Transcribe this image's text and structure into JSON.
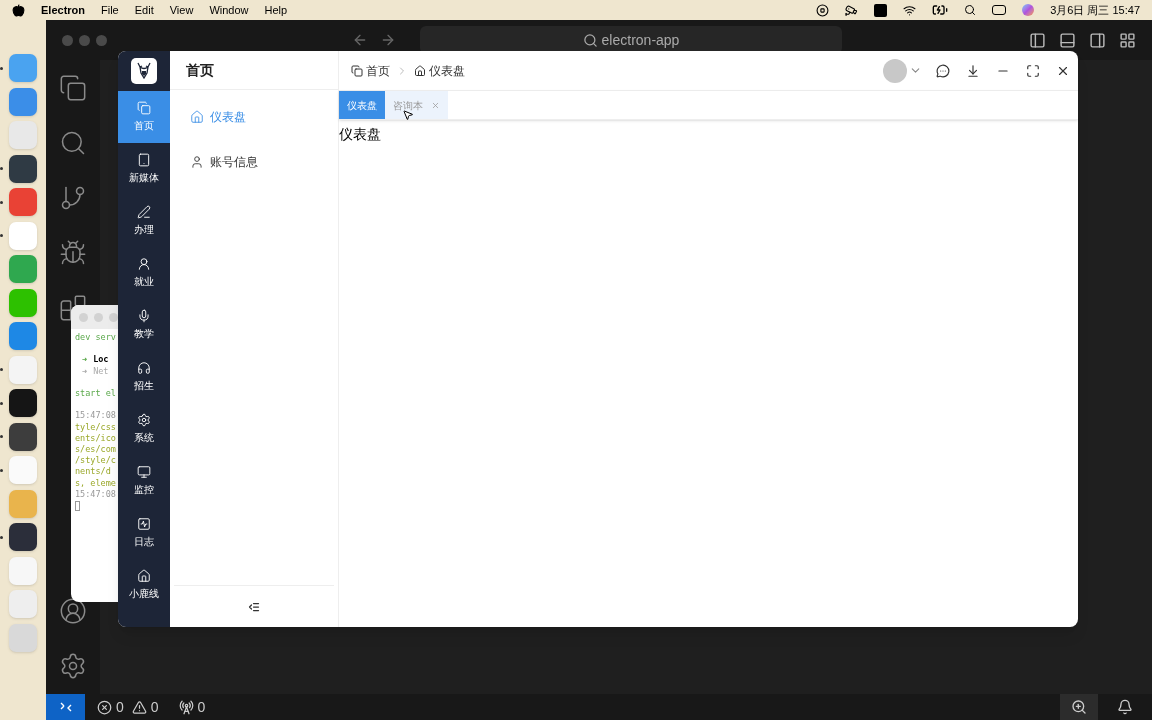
{
  "menubar": {
    "app": "Electron",
    "menus": [
      "File",
      "Edit",
      "View",
      "Window",
      "Help"
    ],
    "clock": "3月6日 周三 15:47"
  },
  "dock": {
    "items": [
      {
        "color": "#4aa3f0",
        "running": true
      },
      {
        "color": "#3b8ee8",
        "running": false
      },
      {
        "color": "#e8e8e8",
        "running": false
      },
      {
        "color": "#2f3a44",
        "running": true
      },
      {
        "color": "#e94235",
        "running": true
      },
      {
        "color": "#ffffff",
        "running": true
      },
      {
        "color": "#2fa84f",
        "running": false
      },
      {
        "color": "#2dc100",
        "running": false
      },
      {
        "color": "#1e88e5",
        "running": false
      },
      {
        "color": "#f4f4f4",
        "running": true
      },
      {
        "color": "#151515",
        "running": true
      },
      {
        "color": "#3d3d3d",
        "running": true
      },
      {
        "color": "#fafafa",
        "running": true
      },
      {
        "color": "#e9b44c",
        "running": false
      },
      {
        "color": "#2b2e3a",
        "running": true
      },
      {
        "color": "#f7f7f7",
        "running": false
      },
      {
        "color": "#eeeeee",
        "running": false
      },
      {
        "color": "#d9d9d9",
        "running": false
      }
    ]
  },
  "editor": {
    "search": "electron-app",
    "status": {
      "errors": "0",
      "warnings": "0",
      "ports": "0"
    }
  },
  "terminal": {
    "lines": [
      {
        "kind": "info",
        "text": "dev serv"
      },
      {
        "kind": "blank"
      },
      {
        "kind": "local",
        "marker": "➜",
        "text": "Loc"
      },
      {
        "kind": "net",
        "marker": "➜",
        "text": "Net"
      },
      {
        "kind": "blank"
      },
      {
        "kind": "info",
        "text": "start el"
      },
      {
        "kind": "blank"
      },
      {
        "kind": "time",
        "text": "15:47:08"
      },
      {
        "kind": "log",
        "text": "tyle/css"
      },
      {
        "kind": "log",
        "text": "ents/ico"
      },
      {
        "kind": "log",
        "text": "s/es/com"
      },
      {
        "kind": "log",
        "text": "/style/c"
      },
      {
        "kind": "log",
        "text": "nents/d"
      },
      {
        "kind": "log",
        "text": "s, eleme"
      },
      {
        "kind": "time",
        "text": "15:47:08"
      }
    ]
  },
  "app": {
    "rail": [
      {
        "label": "首页",
        "selected": true
      },
      {
        "label": "新媒体",
        "selected": false
      },
      {
        "label": "办理",
        "selected": false
      },
      {
        "label": "就业",
        "selected": false
      },
      {
        "label": "教学",
        "selected": false
      },
      {
        "label": "招生",
        "selected": false
      },
      {
        "label": "系统",
        "selected": false
      },
      {
        "label": "监控",
        "selected": false
      },
      {
        "label": "日志",
        "selected": false
      },
      {
        "label": "小鹿线",
        "selected": false
      }
    ],
    "submenu": {
      "title": "首页",
      "items": [
        {
          "label": "仪表盘",
          "selected": true
        },
        {
          "label": "账号信息",
          "selected": false
        }
      ]
    },
    "breadcrumb": [
      "首页",
      "仪表盘"
    ],
    "tabs": [
      {
        "label": "仪表盘",
        "selected": true,
        "closable": false
      },
      {
        "label": "咨询本",
        "selected": false,
        "closable": true
      }
    ],
    "content": "仪表盘"
  }
}
